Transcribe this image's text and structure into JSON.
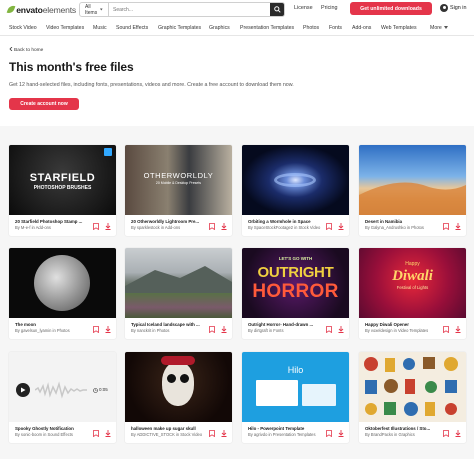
{
  "header": {
    "logo_brand": "envato",
    "logo_product": "elements",
    "search_category": "All Items",
    "search_placeholder": "Search...",
    "license": "License",
    "pricing": "Pricing",
    "cta": "Get unlimited downloads",
    "sign_in": "Sign in"
  },
  "categories": [
    "Stock Video",
    "Video Templates",
    "Music",
    "Sound Effects",
    "Graphic Templates",
    "Graphics",
    "Presentation Templates",
    "Photos",
    "Fonts",
    "Add-ons",
    "Web Templates",
    "More"
  ],
  "page": {
    "back": "Back to home",
    "title": "This month's free files",
    "subtitle": "Get 12 hand-selected files, including fonts, presentations, videos and more. Create a free account to download them now.",
    "create_button": "Create account now"
  },
  "cards": [
    {
      "title": "20 Starfield Photoshop Stamp ...",
      "by": "By M-e-f in Add-ons",
      "thumb_text": "STARFIELD",
      "thumb_sub": "PHOTOSHOP BRUSHES"
    },
    {
      "title": "20 Otherworldly Lightroom Pre...",
      "by": "By sparklestock in Add-ons",
      "thumb_text": "OTHERWORLDLY",
      "thumb_sub": "20 Mobile & Desktop Presets"
    },
    {
      "title": "Orbiting a Wormhole in Space",
      "by": "By SpaceStockFootage2 in Stock Video"
    },
    {
      "title": "Desert in Namibia",
      "by": "By Galyna_Andrushko in Photos"
    },
    {
      "title": "The moon",
      "by": "By gavelsun_lyamin in Photos"
    },
    {
      "title": "Typical Iceland landscape with ...",
      "by": "By nanckrit in Photos"
    },
    {
      "title": "Outright Horror- Hand-drawn ...",
      "by": "By dirtgraft in Fonts",
      "thumb_text": "OUTRIGHT",
      "thumb_sub": "HORROR",
      "thumb_top": "LET'S GO WITH"
    },
    {
      "title": "Happy Diwali Opener",
      "by": "By voxeldesign in Video Templates",
      "thumb_text": "Diwali",
      "thumb_sub": "Festival of Lights",
      "thumb_top": "Happy"
    },
    {
      "title": "Spooky Ghostly Notification",
      "by": "By sonic-boom in Sound Effects",
      "thumb_time": "0:05"
    },
    {
      "title": "halloween make up sugar skull",
      "by": "By ADDICTIVE_STOCK in Stock Video"
    },
    {
      "title": "Hilo - Powerpoint Template",
      "by": "By agrivdo in Presentation Templates",
      "thumb_text": "Hilo"
    },
    {
      "title": "Oktoberfest Illustrations / Sto...",
      "by": "By BrandPacks in Graphics"
    }
  ],
  "colors": {
    "accent": "#e4354a",
    "brand_green": "#82b541"
  }
}
